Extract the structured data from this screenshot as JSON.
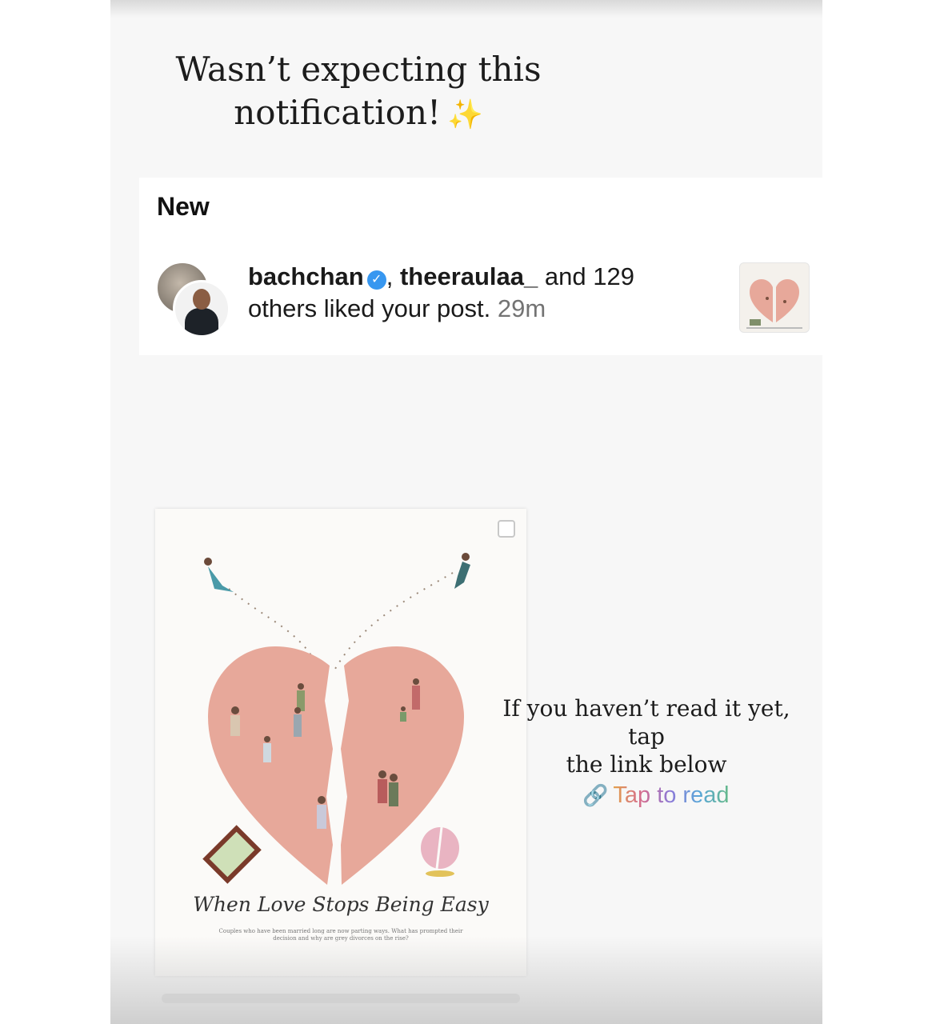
{
  "story": {
    "caption_line1": "Wasn’t expecting this",
    "caption_line2": "notification!",
    "sparkle": "✨",
    "cta_line1": "If you haven’t read it yet, tap",
    "cta_line2": "the link below",
    "link_label": "Tap to read",
    "link_icon": "link-icon"
  },
  "notification": {
    "section_label": "New",
    "user1": "bachchan",
    "separator": ", ",
    "user2": "theeraulaa_",
    "rest_line1": " and 129",
    "rest_line2": "others liked your post.",
    "time": "29m"
  },
  "post": {
    "title": "When Love Stops Being Easy",
    "subtitle": "Couples who have been married long are now parting ways. What has prompted their decision and why are grey divorces on the rise?"
  },
  "colors": {
    "heart": "#e7a89a",
    "verified": "#3797f0",
    "time": "#737373"
  }
}
